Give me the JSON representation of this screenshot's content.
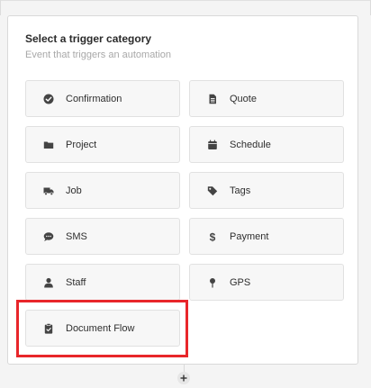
{
  "panel": {
    "title": "Select a trigger category",
    "subtitle": "Event that triggers an automation"
  },
  "categories": [
    {
      "label": "Confirmation",
      "icon": "check-circle-icon"
    },
    {
      "label": "Quote",
      "icon": "document-icon"
    },
    {
      "label": "Project",
      "icon": "folder-icon"
    },
    {
      "label": "Schedule",
      "icon": "calendar-icon"
    },
    {
      "label": "Job",
      "icon": "truck-icon"
    },
    {
      "label": "Tags",
      "icon": "tag-icon"
    },
    {
      "label": "SMS",
      "icon": "chat-bubble-icon"
    },
    {
      "label": "Payment",
      "icon": "dollar-icon"
    },
    {
      "label": "Staff",
      "icon": "person-icon"
    },
    {
      "label": "GPS",
      "icon": "map-pin-icon"
    },
    {
      "label": "Document Flow",
      "icon": "clipboard-icon"
    }
  ],
  "colors": {
    "highlight": "#e8262a",
    "icon": "#444444"
  }
}
